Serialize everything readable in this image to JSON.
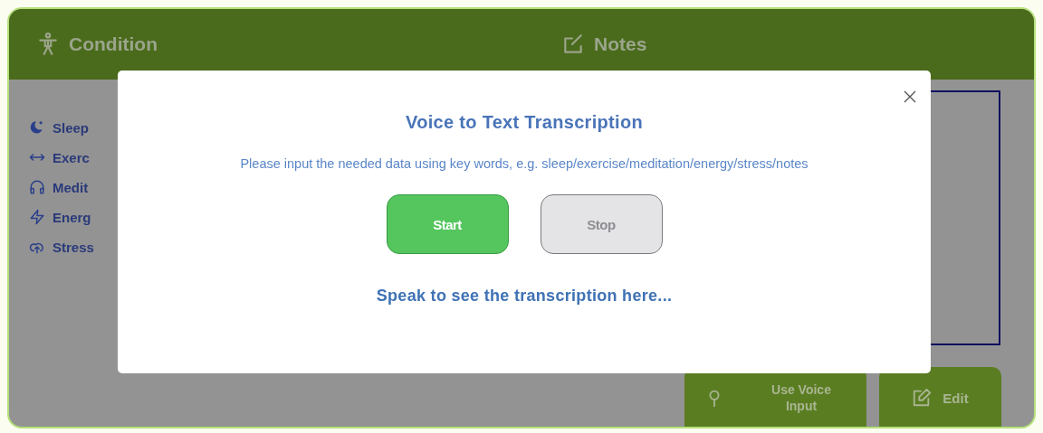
{
  "header": {
    "sections": [
      {
        "kind": "condition",
        "label": "Condition"
      },
      {
        "kind": "notes",
        "label": "Notes"
      }
    ]
  },
  "sidebar": {
    "items": [
      {
        "kind": "sleep",
        "label": "Sleep"
      },
      {
        "kind": "exercise",
        "label": "Exerc"
      },
      {
        "kind": "meditation",
        "label": "Medit"
      },
      {
        "kind": "energy",
        "label": "Energ"
      },
      {
        "kind": "stress",
        "label": "Stress"
      }
    ]
  },
  "actions": [
    {
      "kind": "voice",
      "label": "Use Voice Input"
    },
    {
      "kind": "edit",
      "label": "Edit"
    }
  ],
  "modal": {
    "title": "Voice to Text Transcription",
    "instructions": "Please input the needed data using key words, e.g. sleep/exercise/meditation/energy/stress/notes",
    "buttons": [
      {
        "label": "Start",
        "disabled": false
      },
      {
        "label": "Stop",
        "disabled": true
      }
    ],
    "transcript_placeholder": "Speak to see the transcription here..."
  }
}
